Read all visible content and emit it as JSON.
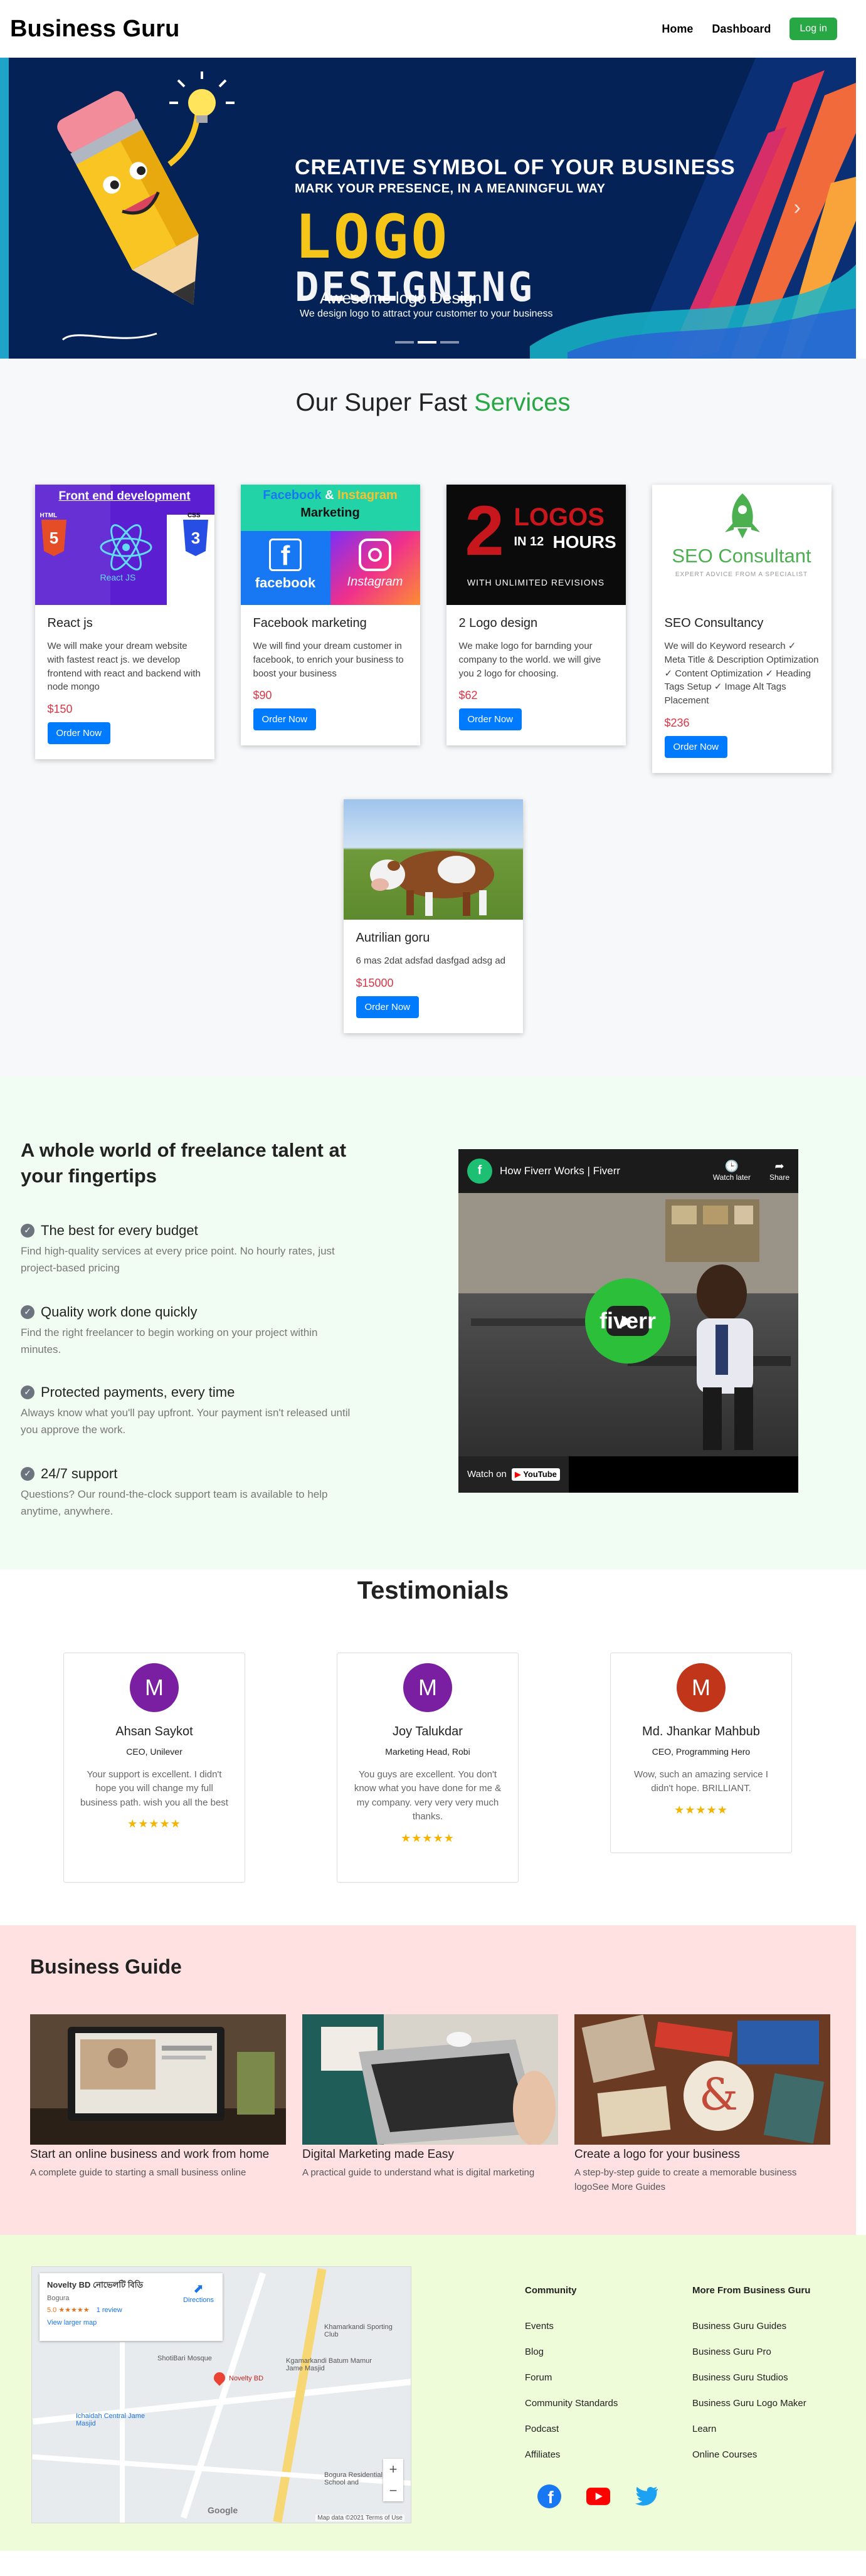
{
  "navbar": {
    "brand": "Business Guru",
    "links": [
      "Home",
      "Dashboard"
    ],
    "login_label": "Log in"
  },
  "hero": {
    "headline": "CREATIVE SYMBOL OF YOUR BUSINESS",
    "subheadline": "MARK YOUR PRESENCE, IN A MEANINGFUL WAY",
    "logo_word": "LOGO",
    "design_word": "DESIGNING",
    "caption_title": "Awesome logo Design",
    "caption_text": "We design logo to attract your customer to your business",
    "next_arrow": "›",
    "slides": 3,
    "active_slide": 2
  },
  "services": {
    "title_prefix": "Our Super Fast",
    "title_highlight": "Services",
    "order_label": "Order Now",
    "cards": [
      {
        "title": "React js",
        "text": "We will make your dream website with fastest react js. we develop frontend with react and backend with node mongo",
        "price": "$150",
        "image": {
          "heading": "Front end development",
          "html": "HTML",
          "css": "CSS",
          "react": "React JS"
        }
      },
      {
        "title": "Facebook marketing",
        "text": "We will find your dream customer in facebook, to enrich your business to boost your business",
        "price": "$90",
        "image": {
          "line1a": "Facebook",
          "line1b": "Instagram",
          "line2": "Marketing",
          "fb": "facebook",
          "ig": "Instagram"
        }
      },
      {
        "title": "2 Logo design",
        "text": "We make logo for barnding your company to the world. we will give you 2 logo for choosing.",
        "price": "$62",
        "image": {
          "big": "2",
          "logos": "LOGOS",
          "in12": "IN 12",
          "hours": "HOURS",
          "unlimited": "WITH UNLIMITED REVISIONS"
        }
      },
      {
        "title": "SEO Consultancy",
        "text": "We will do Keyword research ✓ Meta Title & Description Optimization ✓ Content Optimization ✓ Heading Tags Setup ✓ Image Alt Tags Placement",
        "price": "$236",
        "image": {
          "title": "SEO Consultant",
          "sub": "EXPERT ADVICE FROM A SPECIALIST"
        }
      }
    ],
    "card5": {
      "title": "Autrilian goru",
      "text": "6 mas 2dat adsfad dasfgad adsg ad",
      "price": "$15000"
    }
  },
  "freelance": {
    "title": "A whole world of freelance talent at your fingertips",
    "items": [
      {
        "title": "The best for every budget",
        "text": "Find high-quality services at every price point. No hourly rates, just project-based pricing"
      },
      {
        "title": "Quality work done quickly",
        "text": "Find the right freelancer to begin working on your project within minutes."
      },
      {
        "title": "Protected payments, every time",
        "text": "Always know what you'll pay upfront. Your payment isn't released until you approve the work."
      },
      {
        "title": "24/7 support",
        "text": "Questions? Our round-the-clock support team is available to help anytime, anywhere."
      }
    ],
    "video": {
      "title": "How Fiverr Works | Fiverr",
      "watch_later": "Watch later",
      "share": "Share",
      "watch_on": "Watch on",
      "youtube": "YouTube",
      "overlay": "fiverr"
    }
  },
  "testimonials": {
    "title": "Testimonials",
    "stars": "★★★★★",
    "items": [
      {
        "initial": "M",
        "name": "Ahsan Saykot",
        "role": "CEO, Unilever",
        "quote": "Your support is excellent. I didn't hope you will change my full business path. wish you all the best",
        "color": "#7b1fa2"
      },
      {
        "initial": "M",
        "name": "Joy Talukdar",
        "role": "Marketing Head, Robi",
        "quote": "You guys are excellent. You don't know what you have done for me & my company. very very very much thanks.",
        "color": "#7b1fa2"
      },
      {
        "initial": "M",
        "name": "Md. Jhankar Mahbub",
        "role": "CEO, Programming Hero",
        "quote": "Wow, such an amazing service I didn't hope. BRILLIANT.",
        "color": "#c1361b"
      }
    ]
  },
  "guide": {
    "title": "Business Guide",
    "items": [
      {
        "title": "Start an online business and work from home",
        "text": "A complete guide to starting a small business online"
      },
      {
        "title": "Digital Marketing made Easy",
        "text": "A practical guide to understand what is digital marketing"
      },
      {
        "title": "Create a logo for your business",
        "text": "A step-by-step guide to create a memorable business logoSee More Guides"
      }
    ]
  },
  "map": {
    "place": "Novelty BD নোভেলটি বিডি",
    "city": "Bogura",
    "rating": "5.0 ★★★★★",
    "reviews": "1 review",
    "larger_map": "View larger map",
    "directions": "Directions",
    "labels": [
      "Khamarkandi Sporting Club",
      "ShotiBari Mosque",
      "Kgamarkandi Batum Mamur Jame Masjid",
      "Novelty BD",
      "Ichaidah Central Jame Masjid",
      "Bogura Residential School and",
      "Google",
      "Map data ©2021",
      "Terms of Use"
    ]
  },
  "footer": {
    "community_title": "Community",
    "community_links": [
      "Events",
      "Blog",
      "Forum",
      "Community Standards",
      "Podcast",
      "Affiliates"
    ],
    "more_title": "More From Business Guru",
    "more_links": [
      "Business Guru Guides",
      "Business Guru Pro",
      "Business Guru Studios",
      "Business Guru Logo Maker",
      "Learn",
      "Online Courses"
    ],
    "social_icons": [
      "facebook-icon",
      "youtube-icon",
      "twitter-icon"
    ]
  },
  "colors": {
    "brand_green": "#28a745",
    "primary_blue": "#007bff",
    "price_red": "#dc3545",
    "hero_navy": "#052257",
    "freelance_bg": "#f1fdf3",
    "guide_bg": "#ffe1e1",
    "footer_bg": "#eefcd9"
  }
}
